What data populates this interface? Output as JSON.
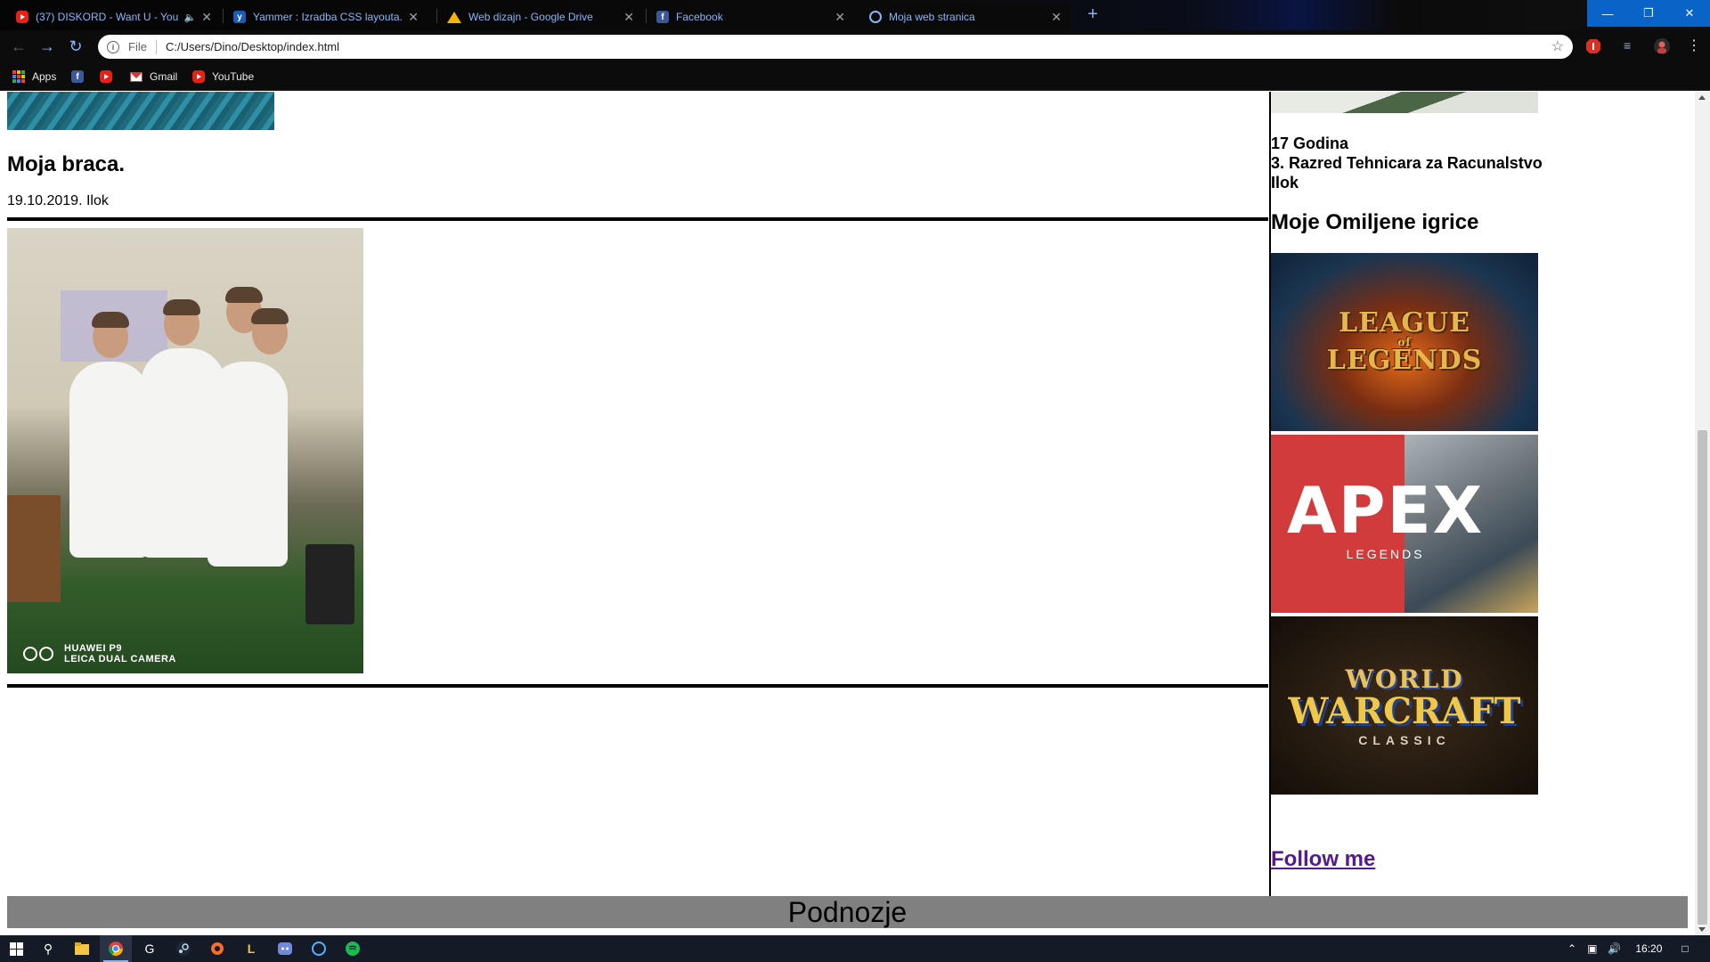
{
  "browser": {
    "tabs": [
      {
        "title": "(37) DISKORD - Want U - You",
        "icon": "youtube-icon",
        "audio": true
      },
      {
        "title": "Yammer : Izradba CSS layouta.pp",
        "icon": "yammer-icon"
      },
      {
        "title": "Web dizajn - Google Drive",
        "icon": "google-drive-icon"
      },
      {
        "title": "Facebook",
        "icon": "facebook-icon"
      },
      {
        "title": "Moja web stranica",
        "icon": "globe-icon",
        "active": true
      }
    ],
    "address": {
      "scheme_label": "File",
      "url": "C:/Users/Dino/Desktop/index.html"
    },
    "bookmarks": [
      {
        "label": "Apps",
        "icon": "apps-grid-icon"
      },
      {
        "label": "",
        "icon": "facebook-icon"
      },
      {
        "label": "",
        "icon": "youtube-icon"
      },
      {
        "label": "Gmail",
        "icon": "gmail-icon"
      },
      {
        "label": "YouTube",
        "icon": "youtube-icon"
      }
    ]
  },
  "page": {
    "post": {
      "title": "Moja braca.",
      "date": "19.10.2019. Ilok",
      "photo_watermark_line1": "HUAWEI P9",
      "photo_watermark_line2": "LEICA DUAL CAMERA"
    },
    "sidebar": {
      "info_lines": [
        "17 Godina",
        "3. Razred Tehnicara za Racunalstvo",
        "Ilok"
      ],
      "games_heading": "Moje Omiljene igrice",
      "games": [
        {
          "logo_line1": "LEAGUE",
          "logo_line2": "LEGENDS",
          "logo_of": "of"
        },
        {
          "logo_big": "APEX",
          "logo_small": "LEGENDS"
        },
        {
          "logo_line1": "WORLD",
          "logo_line2": "WARCRAFT",
          "logo_small": "CLASSIC"
        }
      ],
      "follow_link": "Follow me"
    },
    "footer": "Podnozje"
  },
  "taskbar": {
    "clock": "16:20"
  },
  "colors": {
    "link_visited": "#551a8b",
    "footer_bg": "#808080",
    "tab_text": "#8ab4f8",
    "window_buttons": "#0a64c7"
  }
}
